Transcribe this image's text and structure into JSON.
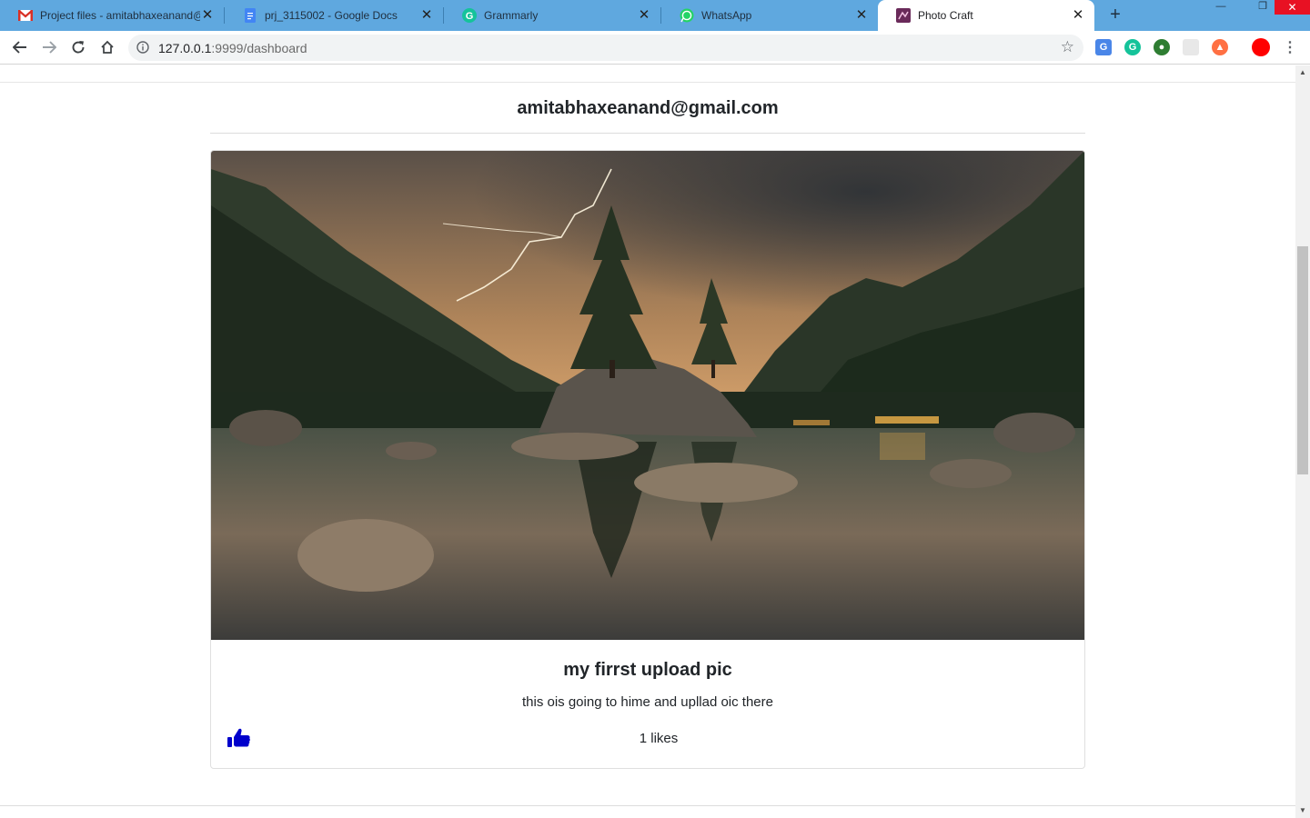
{
  "browser": {
    "tabs": [
      {
        "title": "Project files - amitabhaxeanand@",
        "icon": "gmail-icon",
        "active": false
      },
      {
        "title": "prj_3115002 - Google Docs",
        "icon": "google-docs-icon",
        "active": false
      },
      {
        "title": "Grammarly",
        "icon": "grammarly-icon",
        "active": false
      },
      {
        "title": "WhatsApp",
        "icon": "whatsapp-icon",
        "active": false
      },
      {
        "title": "Photo Craft",
        "icon": "photo-craft-icon",
        "active": true
      }
    ],
    "close_glyph": "✕",
    "new_tab_glyph": "+",
    "address": {
      "host": "127.0.0.1",
      "rest": ":9999/dashboard"
    },
    "colors": {
      "tabstrip": "#5fa8df",
      "accent_like": "#0000cc"
    }
  },
  "page": {
    "user_email": "amitabhaxeanand@gmail.com",
    "post": {
      "image_subject": "lake-mountain-lightning-photo",
      "title": "my firrst upload pic",
      "description": "this ois going to hime and upllad oic there",
      "likes_text": "1 likes",
      "like_icon": "thumbs-up-icon"
    }
  }
}
